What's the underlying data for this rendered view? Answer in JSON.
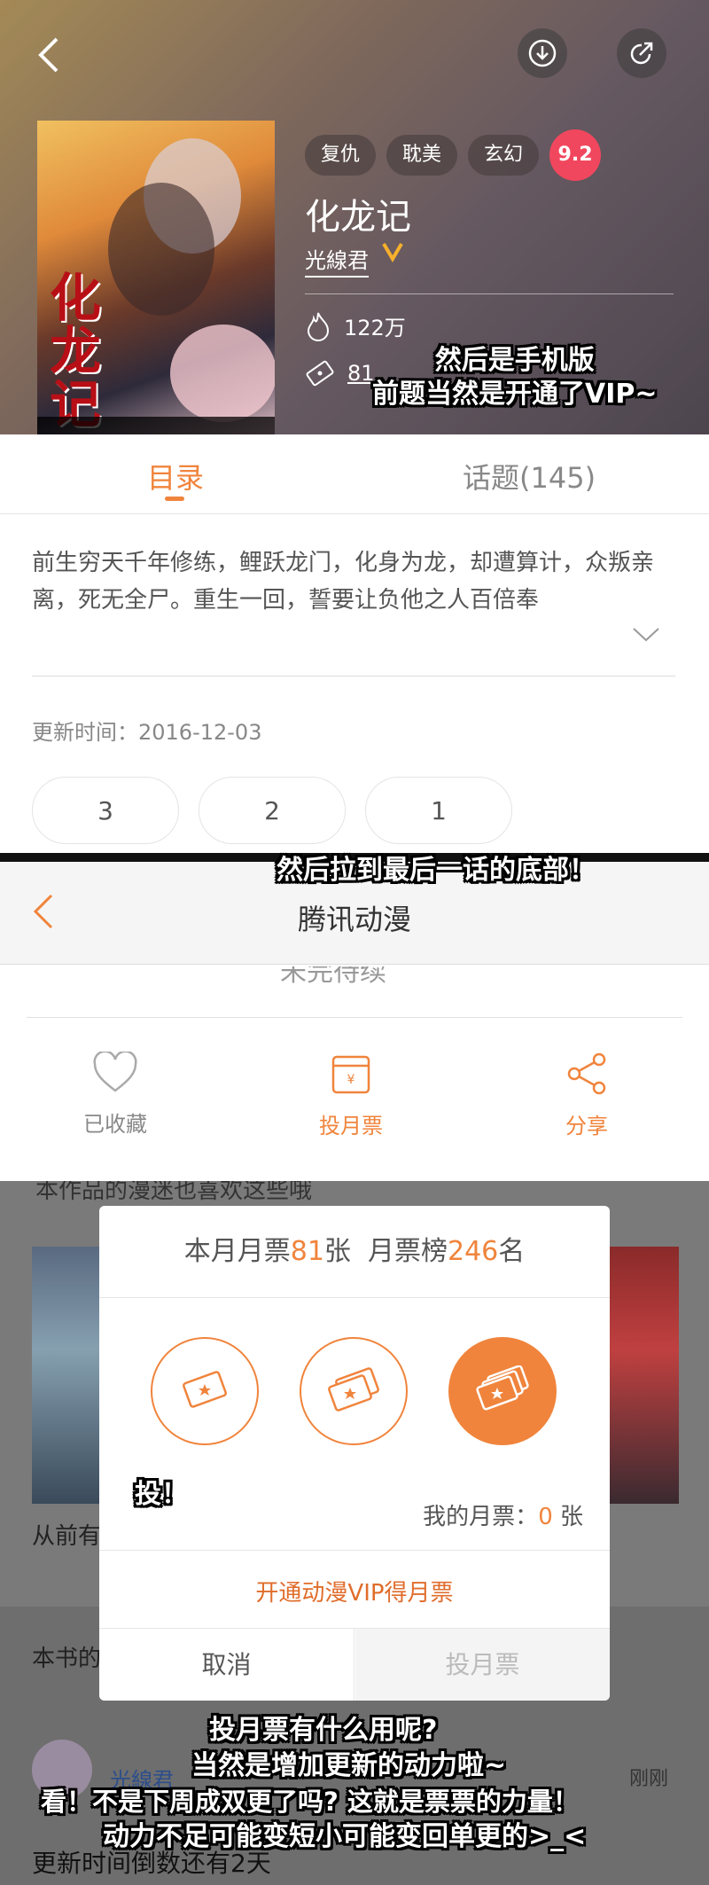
{
  "detail": {
    "tags": [
      "复仇",
      "耽美",
      "玄幻"
    ],
    "score": "9.2",
    "title": "化龙记",
    "author": "光線君",
    "popularity": "122万",
    "tickets": "81",
    "cover_title": "化龙记",
    "tabs": {
      "directory": "目录",
      "topics": "话题(145)"
    },
    "description": "前生穷天千年修练，鲤跃龙门，化身为龙，却遭算计，众叛亲离，死无全尸。重生一回，誓要让负他之人百倍奉",
    "update_time": "更新时间：2016-12-03",
    "episodes": [
      "3",
      "2",
      "1"
    ]
  },
  "captions": {
    "c1_line1": "然后是手机版",
    "c1_line2": "前题当然是开通了VIP~",
    "c2": "然后拉到最后一话的底部！",
    "c3": "投！",
    "c4_line1": "投月票有什么用呢?",
    "c4_line2": "当然是增加更新的动力啦~",
    "c4_line3": "看！不是下周成双更了吗? 这就是票票的力量！",
    "c4_line4": "动力不足可能变短小可能变回单更的>_<"
  },
  "reader": {
    "nav_title": "腾讯动漫",
    "faded_text": "未完待续",
    "actions": {
      "favorite": "已收藏",
      "vote": "投月票",
      "share": "分享"
    }
  },
  "vote_dialog": {
    "head_prefix": "本月月票",
    "head_count": "81",
    "head_mid": "张  月票榜",
    "head_rank": "246",
    "head_suffix": "名",
    "my_prefix": "我的月票：",
    "my_count": "0",
    "my_suffix": " 张",
    "vip_link": "开通动漫VIP得月票",
    "cancel": "取消",
    "confirm": "投月票"
  },
  "background": {
    "line_top": "本作品的漫迷也喜欢这些哦",
    "item_title": "从前有",
    "section": "本书的",
    "comment_user": "光線君",
    "comment_time": "刚刚",
    "comment_text": "更新时间倒数还有2天"
  },
  "colors": {
    "accent": "#f0843c",
    "score": "#f1475e"
  }
}
